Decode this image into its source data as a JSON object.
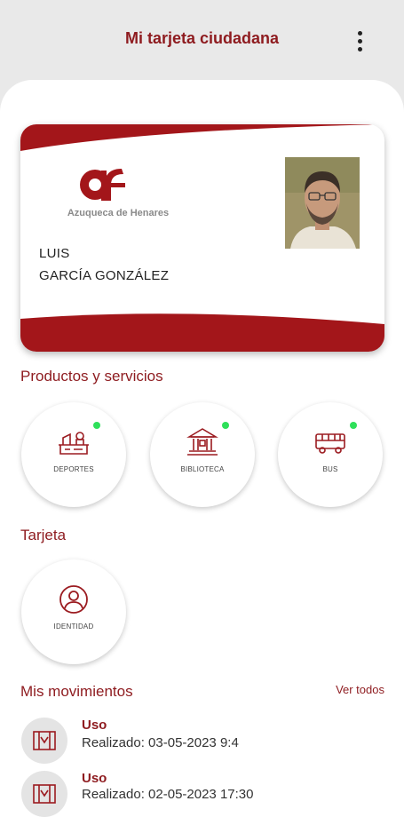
{
  "header": {
    "title": "Mi tarjeta ciudadana",
    "menu_icon": "more-vertical-icon"
  },
  "card": {
    "municipality": "Azuqueca de Henares",
    "first_name": "LUIS",
    "last_name": "GARCÍA GONZÁLEZ",
    "brand_color": "#a3161a"
  },
  "products": {
    "title": "Productos y servicios",
    "items": [
      {
        "label": "DEPORTES",
        "icon": "sports-icon",
        "active": true
      },
      {
        "label": "BIBLIOTECA",
        "icon": "library-icon",
        "active": true
      },
      {
        "label": "BUS",
        "icon": "bus-icon",
        "active": true
      }
    ]
  },
  "card_section": {
    "title": "Tarjeta",
    "items": [
      {
        "label": "IDENTIDAD",
        "icon": "user-icon"
      }
    ]
  },
  "movements": {
    "title": "Mis movimientos",
    "see_all": "Ver todos",
    "items": [
      {
        "type": "Uso",
        "detail": "Realizado: 03-05-2023 9:4",
        "icon": "sports-icon"
      },
      {
        "type": "Uso",
        "detail": "Realizado: 02-05-2023 17:30",
        "icon": "sports-icon"
      }
    ]
  },
  "colors": {
    "accent": "#8e1b1f",
    "status_active": "#2ee05a"
  }
}
